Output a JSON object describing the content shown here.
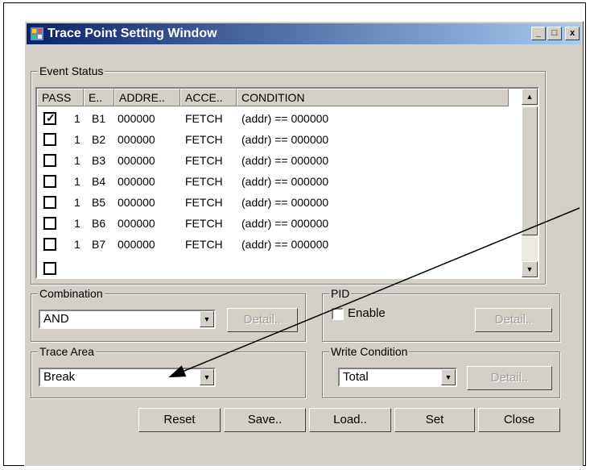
{
  "window": {
    "title": "Trace Point Setting Window",
    "min_label": "_",
    "max_label": "□",
    "close_label": "x"
  },
  "event_status": {
    "group_label": "Event Status",
    "columns": [
      "PASS",
      "E..",
      "ADDRE..",
      "ACCE..",
      "CONDITION"
    ],
    "rows": [
      {
        "checked": true,
        "pass": "1",
        "event": "B1",
        "address": "000000",
        "access": "FETCH",
        "condition": "(addr) == 000000"
      },
      {
        "checked": false,
        "pass": "1",
        "event": "B2",
        "address": "000000",
        "access": "FETCH",
        "condition": "(addr) == 000000"
      },
      {
        "checked": false,
        "pass": "1",
        "event": "B3",
        "address": "000000",
        "access": "FETCH",
        "condition": "(addr) == 000000"
      },
      {
        "checked": false,
        "pass": "1",
        "event": "B4",
        "address": "000000",
        "access": "FETCH",
        "condition": "(addr) == 000000"
      },
      {
        "checked": false,
        "pass": "1",
        "event": "B5",
        "address": "000000",
        "access": "FETCH",
        "condition": "(addr) == 000000"
      },
      {
        "checked": false,
        "pass": "1",
        "event": "B6",
        "address": "000000",
        "access": "FETCH",
        "condition": "(addr) == 000000"
      },
      {
        "checked": false,
        "pass": "1",
        "event": "B7",
        "address": "000000",
        "access": "FETCH",
        "condition": "(addr) == 000000"
      }
    ]
  },
  "combination": {
    "group_label": "Combination",
    "value": "AND",
    "detail_label": "Detail.."
  },
  "pid": {
    "group_label": "PID",
    "enable_label": "Enable",
    "enabled": false,
    "detail_label": "Detail.."
  },
  "trace_area": {
    "group_label": "Trace Area",
    "value": "Break"
  },
  "write_condition": {
    "group_label": "Write Condition",
    "value": "Total",
    "detail_label": "Detail.."
  },
  "buttons": {
    "reset": "Reset",
    "save": "Save..",
    "load": "Load..",
    "set": "Set",
    "close": "Close"
  },
  "icons": {
    "app": "app-icon",
    "dropdown": "dropdown-arrow-icon",
    "scroll_up": "scroll-up-icon",
    "scroll_down": "scroll-down-icon",
    "check": "checkmark-icon",
    "pointer": "annotation-arrow"
  },
  "colors": {
    "titlebar_start": "#0a246a",
    "titlebar_end": "#a6caf0",
    "face": "#d4d0c8"
  }
}
